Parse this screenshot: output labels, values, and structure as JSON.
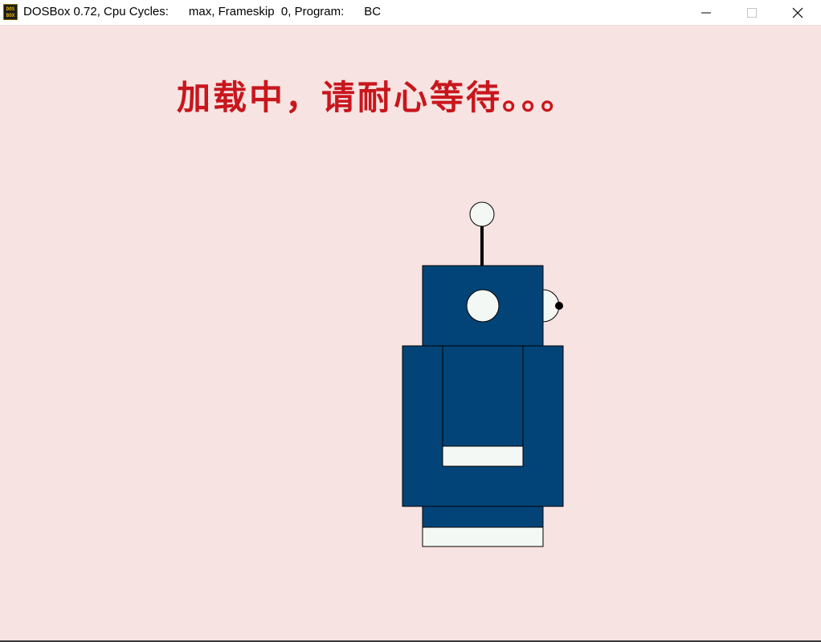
{
  "window": {
    "title": "DOSBox 0.72, Cpu Cycles:      max, Frameskip  0, Program:      BC",
    "icon": "dosbox-icon",
    "icon_text_top": "DOS",
    "icon_text_bottom": "BOX",
    "controls": [
      "minimize-icon",
      "maximize-icon",
      "close-icon"
    ]
  },
  "screen": {
    "background": "#f7e3e1",
    "loading_text": "加载中，请耐心等待。。。",
    "loading_color": "#c8161d",
    "robot_color": "#024477",
    "robot_accent": "#f4f8f5"
  }
}
